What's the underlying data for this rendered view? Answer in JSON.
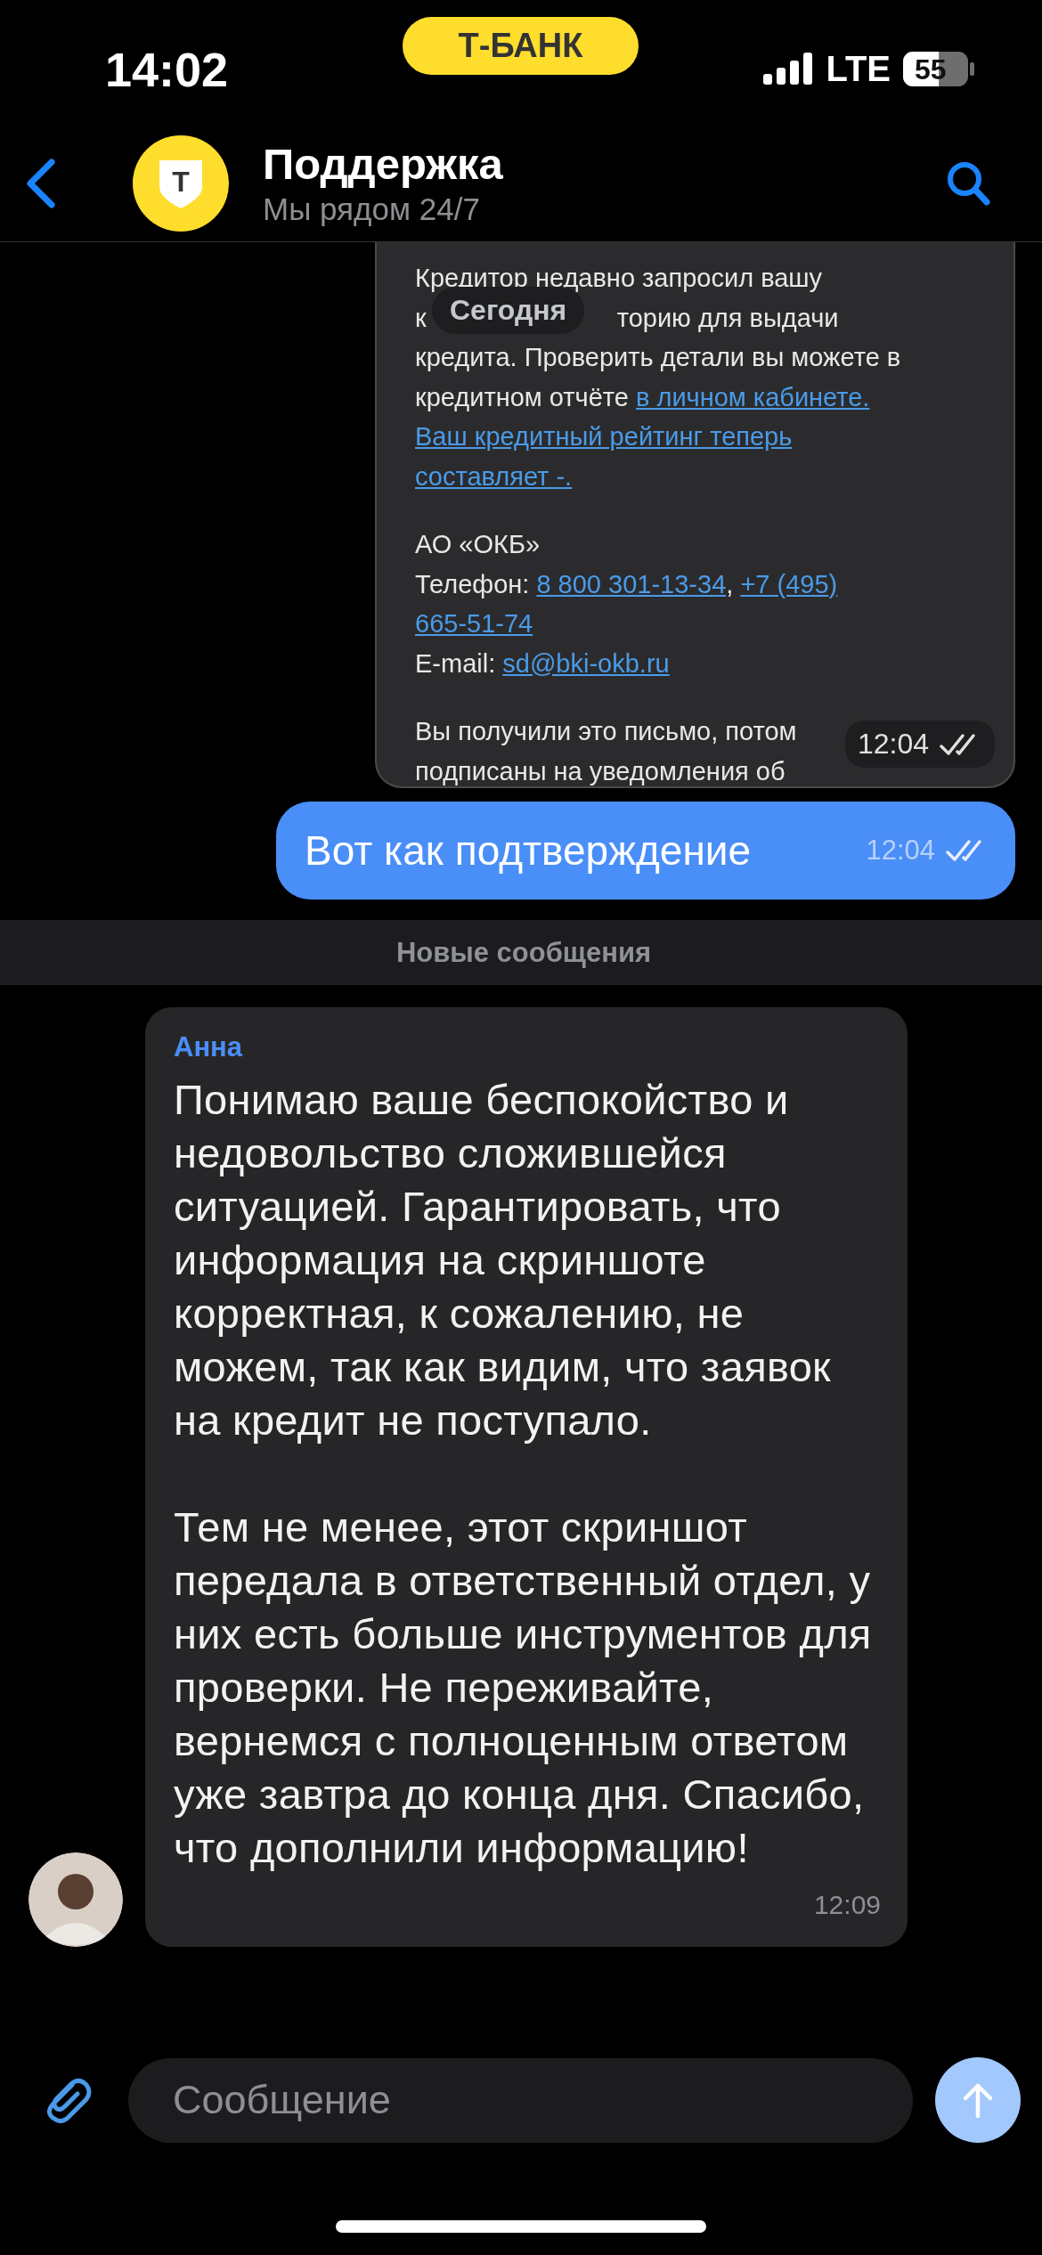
{
  "status_bar": {
    "time": "14:02",
    "badge": "Т-БАНК",
    "network": "LTE",
    "battery": "55"
  },
  "header": {
    "avatar_letter": "Т",
    "title": "Поддержка",
    "subtitle": "Мы рядом 24/7"
  },
  "date_chip": "Сегодня",
  "messages": [
    {
      "kind": "image",
      "outgoing": true,
      "time": "12:04",
      "read": true,
      "paragraphs": [
        [
          [
            {
              "text": "Кредитор недавно запросил вашу",
              "link": false
            }
          ],
          [
            {
              "text": "к",
              "link": false
            },
            {
              "text": "торию для выдачи",
              "link": false,
              "after_cover": true
            }
          ],
          [
            {
              "text": "кредита. Проверить детали вы можете в",
              "link": false
            }
          ],
          [
            {
              "text": "кредитном отчёте ",
              "link": false
            },
            {
              "text": "в личном кабинете.",
              "link": true
            }
          ],
          [
            {
              "text": "Ваш кредитный рейтинг теперь",
              "link": true
            }
          ],
          [
            {
              "text": "составляет -.",
              "link": true
            }
          ]
        ],
        [
          [
            {
              "text": "АО «ОКБ»",
              "link": false
            }
          ],
          [
            {
              "text": "Телефон: ",
              "link": false
            },
            {
              "text": "8 800 301-13-34",
              "link": true
            },
            {
              "text": ", ",
              "link": false
            },
            {
              "text": "+7 (495)",
              "link": true
            }
          ],
          [
            {
              "text": "665-51-74",
              "link": true
            }
          ],
          [
            {
              "text": "E-mail: ",
              "link": false
            },
            {
              "text": "sd@bki-okb.ru",
              "link": true
            }
          ]
        ],
        [
          [
            {
              "text": "Вы получили это письмо, потом",
              "link": false
            }
          ],
          [
            {
              "text": "подписаны на уведомления об",
              "link": false
            }
          ]
        ]
      ]
    },
    {
      "kind": "text",
      "outgoing": true,
      "time": "12:04",
      "read": true,
      "paragraphs": [
        "Вот как подтверждение"
      ]
    },
    {
      "kind": "divider",
      "text": "Новые сообщения"
    },
    {
      "kind": "text",
      "outgoing": false,
      "sender": "Анна",
      "time": "12:09",
      "paragraphs": [
        "Понимаю ваше беспокойство и недовольство сложившейся ситуацией. Гарантировать, что информация на скриншоте корректная, к сожалению, не можем, так как видим, что заявок на кредит не поступало.",
        "Тем не менее, этот скриншот передала в ответственный отдел, у них есть больше инструментов для проверки. Не переживайте, вернемся с полноценным ответом уже завтра до конца дня. Спасибо, что дополнили информацию!"
      ]
    }
  ],
  "composer": {
    "placeholder": "Сообщение",
    "send_disabled": true
  }
}
